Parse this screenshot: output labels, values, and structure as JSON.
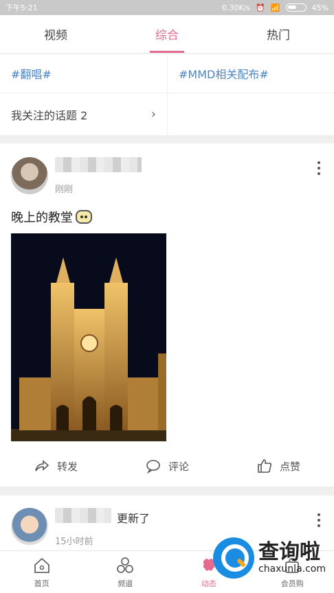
{
  "status": {
    "time": "下午5:21",
    "speed": "0.30K/s",
    "battery": "45%"
  },
  "tabs": [
    {
      "label": "视频"
    },
    {
      "label": "综合"
    },
    {
      "label": "热门"
    }
  ],
  "topics": {
    "left": "#翻唱#",
    "right": "#MMD相关配布#",
    "followed": "我关注的话题 2"
  },
  "post1": {
    "time": "刚刚",
    "text": "晚上的教堂"
  },
  "actions": {
    "share": "转发",
    "comment": "评论",
    "like": "点赞"
  },
  "post2": {
    "suffix": "更新了",
    "time": "15小时前"
  },
  "nav": [
    {
      "label": "首页"
    },
    {
      "label": "频道"
    },
    {
      "label": "动态"
    },
    {
      "label": "会员购"
    }
  ],
  "watermark": {
    "cn": "查询啦",
    "en": "chaxunla.com"
  },
  "colors": {
    "accent": "#e46a8e",
    "topic": "#4a86c5"
  }
}
